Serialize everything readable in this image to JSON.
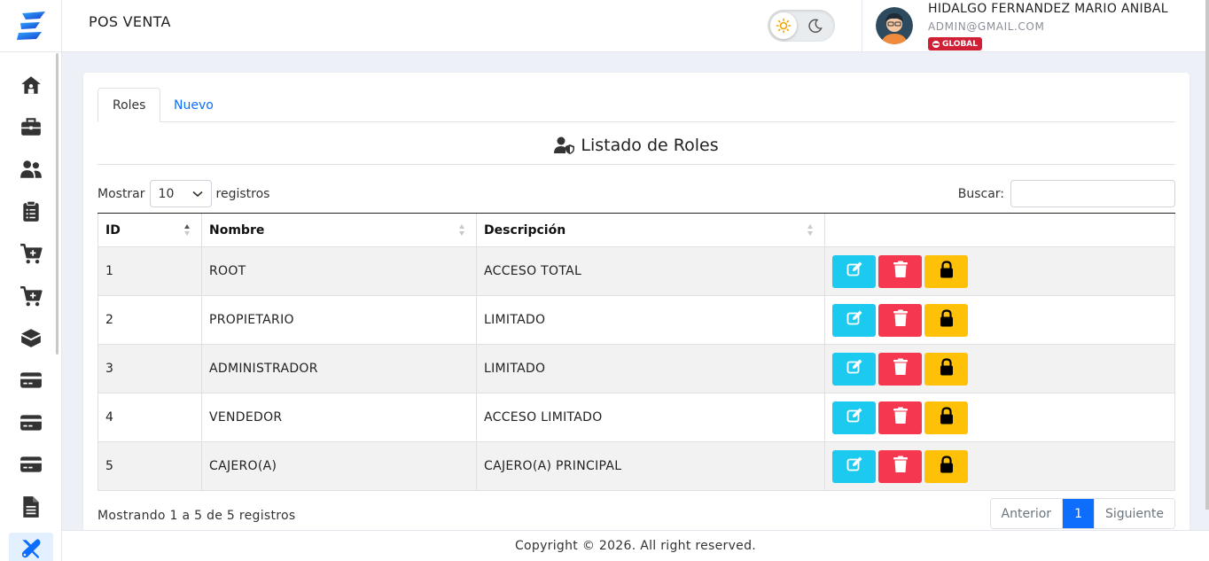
{
  "header": {
    "title": "POS VENTA",
    "user_name": "HIDALGO FERNANDEZ MARIO ANIBAL",
    "user_email": "ADMIN@GMAIL.COM",
    "badge": "GLOBAL"
  },
  "sidebar": {
    "items": [
      {
        "icon": "home-icon"
      },
      {
        "icon": "briefcase-icon"
      },
      {
        "icon": "users-icon"
      },
      {
        "icon": "clipboard-list-icon"
      },
      {
        "icon": "cart-plus-icon"
      },
      {
        "icon": "cart-plus-icon"
      },
      {
        "icon": "box-open-icon"
      },
      {
        "icon": "credit-card-icon"
      },
      {
        "icon": "credit-card-icon"
      },
      {
        "icon": "credit-card-icon"
      },
      {
        "icon": "file-icon"
      },
      {
        "icon": "tools-icon",
        "active": true
      }
    ]
  },
  "tabs": [
    "Roles",
    "Nuevo"
  ],
  "card_title": "Listado de Roles",
  "length": {
    "label_before": "Mostrar",
    "value": "10",
    "label_after": "registros"
  },
  "search": {
    "label": "Buscar:",
    "placeholder": ""
  },
  "table": {
    "headers": [
      "ID",
      "Nombre",
      "Descripción",
      ""
    ],
    "rows": [
      {
        "id": "1",
        "name": "ROOT",
        "description": "ACCESO TOTAL"
      },
      {
        "id": "2",
        "name": "PROPIETARIO",
        "description": "LIMITADO"
      },
      {
        "id": "3",
        "name": "ADMINISTRADOR",
        "description": "LIMITADO"
      },
      {
        "id": "4",
        "name": "VENDEDOR",
        "description": "ACCESO LIMITADO"
      },
      {
        "id": "5",
        "name": "CAJERO(A)",
        "description": "CAJERO(A) PRINCIPAL"
      }
    ]
  },
  "info": "Mostrando 1 a 5 de 5 registros",
  "pagination": {
    "prev": "Anterior",
    "current": "1",
    "next": "Siguiente"
  },
  "footer": "Copyright © 2026. All right reserved.",
  "colors": {
    "accent": "#0d6efd",
    "edit": "#1ccaf0",
    "delete": "#f5384f",
    "lock": "#ffc107",
    "badge": "#d11f36"
  }
}
